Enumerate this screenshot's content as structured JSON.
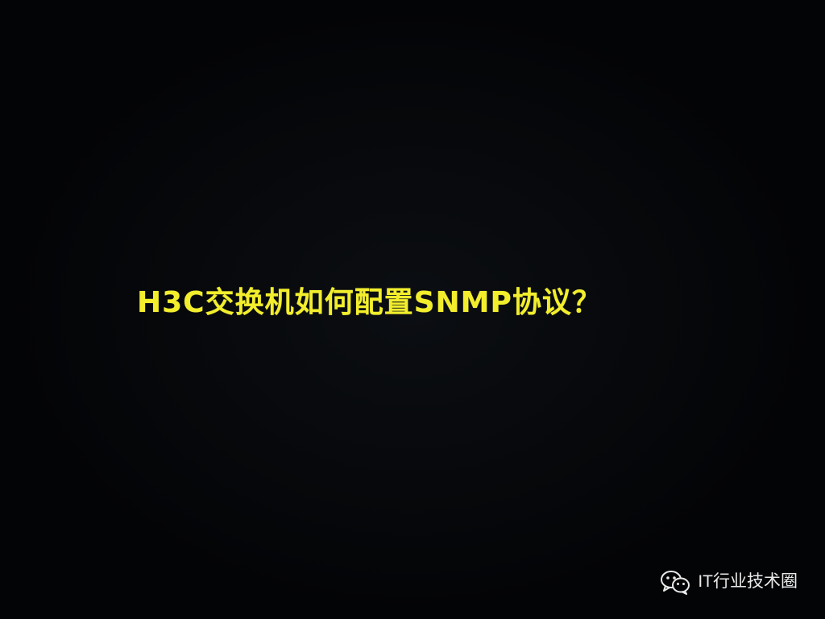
{
  "slide": {
    "headline": "H3C交换机如何配置SNMP协议？",
    "headline_color": "#f2ee2c",
    "background_color": "#030406"
  },
  "watermark": {
    "icon": "wechat-icon",
    "text": "IT行业技术圈",
    "color": "#e9e9e9"
  }
}
